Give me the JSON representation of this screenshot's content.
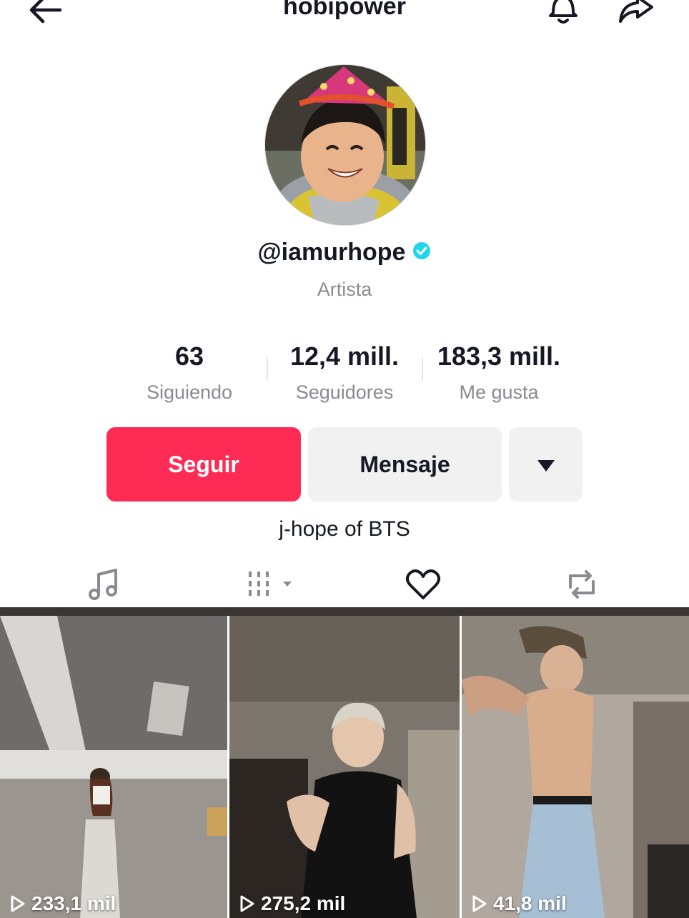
{
  "header": {
    "title": "hobipower",
    "icons": [
      "back-arrow-icon",
      "bell-icon",
      "share-icon"
    ]
  },
  "profile": {
    "handle": "@iamurhope",
    "verified": true,
    "category": "Artista",
    "bio": "j-hope of BTS"
  },
  "stats": [
    {
      "value": "63",
      "label": "Siguiendo"
    },
    {
      "value": "12,4 mill.",
      "label": "Seguidores"
    },
    {
      "value": "183,3 mill.",
      "label": "Me gusta"
    }
  ],
  "actions": {
    "follow_label": "Seguir",
    "message_label": "Mensaje",
    "more_icon": "caret-down-icon"
  },
  "tabs": [
    "music-note-icon",
    "grid-filter-icon",
    "heart-icon",
    "repost-icon"
  ],
  "videos": [
    {
      "views": "233,1 mil"
    },
    {
      "views": "275,2 mil"
    },
    {
      "views": "41,8 mil"
    }
  ],
  "colors": {
    "accent": "#fe2c55",
    "verified": "#20d5ec",
    "secondary_text": "#8a8b91",
    "button_bg": "#f1f1f2"
  }
}
